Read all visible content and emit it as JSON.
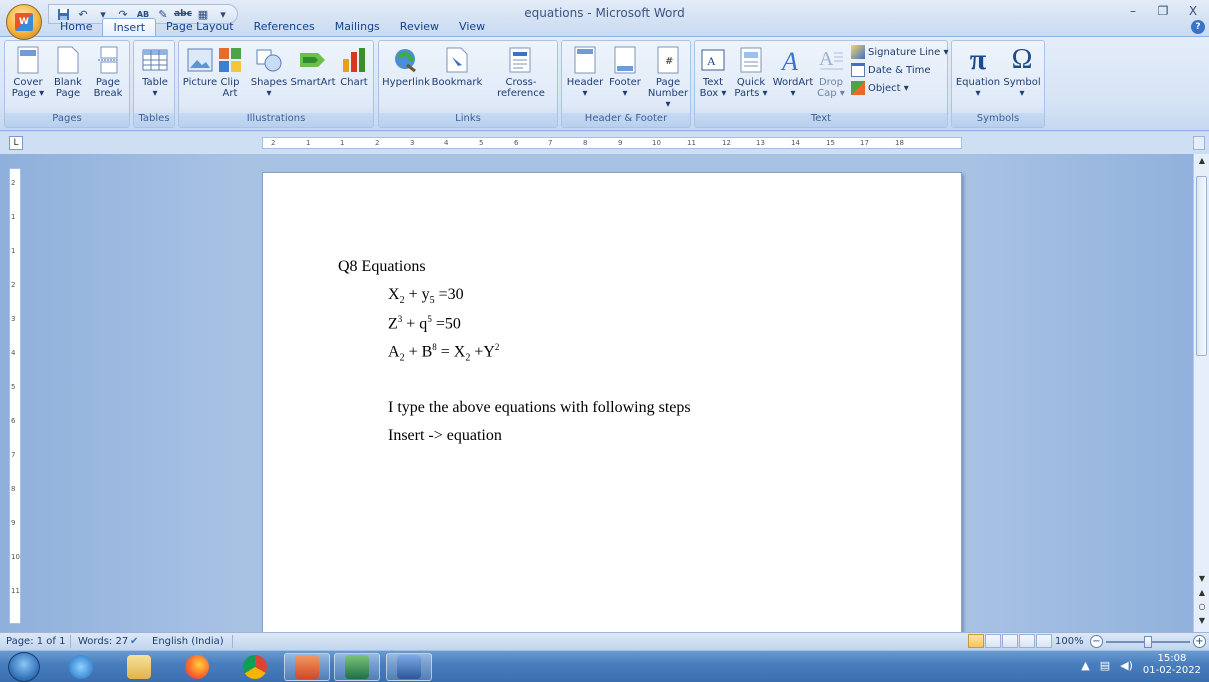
{
  "window": {
    "title": "equations - Microsoft Word"
  },
  "tabs": [
    "Home",
    "Insert",
    "Page Layout",
    "References",
    "Mailings",
    "Review",
    "View"
  ],
  "ribbon": {
    "pages": {
      "label": "Pages",
      "buttons": [
        "Cover\nPage ▾",
        "Blank\nPage",
        "Page\nBreak"
      ]
    },
    "tables": {
      "label": "Tables",
      "buttons": [
        "Table\n▾"
      ]
    },
    "illustrations": {
      "label": "Illustrations",
      "buttons": [
        "Picture",
        "Clip\nArt",
        "Shapes\n▾",
        "SmartArt",
        "Chart"
      ]
    },
    "links": {
      "label": "Links",
      "buttons": [
        "Hyperlink",
        "Bookmark",
        "Cross-reference"
      ]
    },
    "header_footer": {
      "label": "Header & Footer",
      "buttons": [
        "Header\n▾",
        "Footer\n▾",
        "Page\nNumber ▾"
      ]
    },
    "text": {
      "label": "Text",
      "buttons": [
        "Text\nBox ▾",
        "Quick\nParts ▾",
        "WordArt\n▾",
        "Drop\nCap ▾"
      ],
      "small": [
        "Signature Line ▾",
        "Date & Time",
        "Object ▾"
      ]
    },
    "symbols": {
      "label": "Symbols",
      "buttons": [
        "Equation\n▾",
        "Symbol\n▾"
      ]
    }
  },
  "ruler": {
    "ticks": [
      "2",
      "1",
      "1",
      "2",
      "3",
      "4",
      "5",
      "6",
      "7",
      "8",
      "9",
      "10",
      "11",
      "12",
      "13",
      "14",
      "15",
      "17",
      "18"
    ],
    "vticks": [
      "2",
      "1",
      "1",
      "2",
      "3",
      "4",
      "5",
      "6",
      "7",
      "8",
      "9",
      "10",
      "11"
    ]
  },
  "document": {
    "heading": "Q8 Equations",
    "eq1": {
      "a": "X",
      "a_sub": "2",
      "b": " + y",
      "b_sub": "5",
      "c": " =30"
    },
    "eq2": {
      "a": "Z",
      "a_sup": "3",
      "b": " + q",
      "b_sup": "5",
      "c": " =50"
    },
    "eq3": {
      "a": "A",
      "a_sub": "2",
      "b": "  + B",
      "b_sup": "8",
      "c": " = X",
      "c_sub": "2",
      "d": " +Y",
      "d_sup": "2"
    },
    "line4": "I type the above equations with following steps",
    "line5": "Insert -> equation"
  },
  "status": {
    "page": "Page: 1 of 1",
    "words": "Words: 27",
    "language": "English (India)",
    "zoom": "100%"
  },
  "tray": {
    "time": "15:08",
    "date": "01-02-2022"
  },
  "colors": {
    "ribbon_bg": "#d6e4f6",
    "doc_bg": "#a8c2e4",
    "taskbar": "#4a7fbf",
    "accent": "#15428b"
  }
}
